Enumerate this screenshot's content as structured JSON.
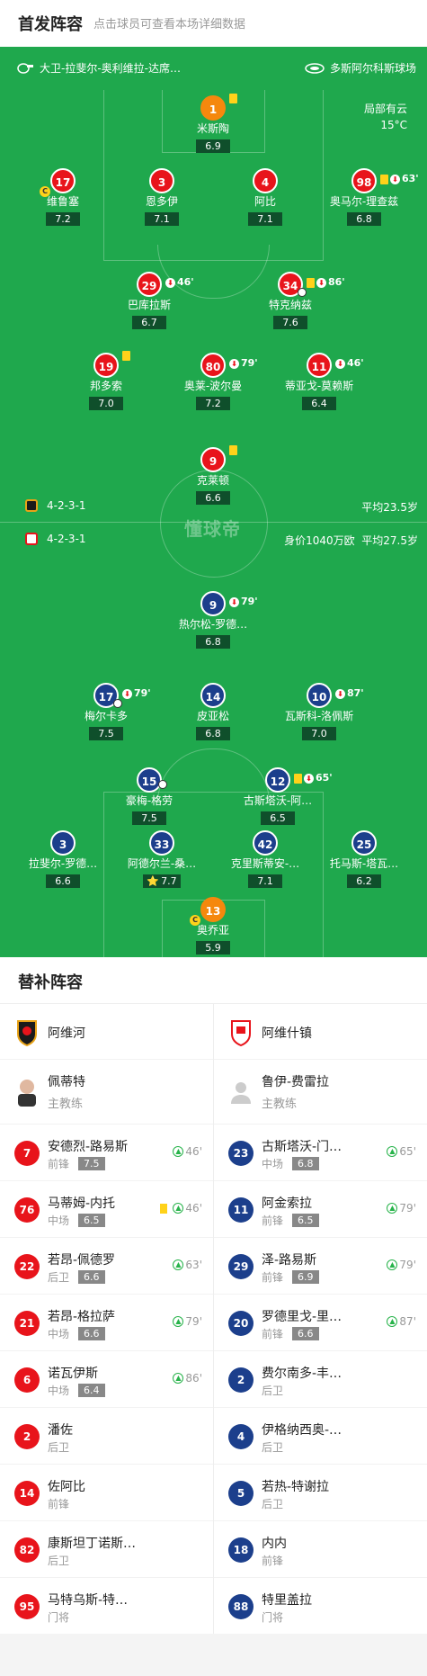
{
  "header": {
    "title": "首发阵容",
    "subtitle": "点击球员可查看本场详细数据"
  },
  "match": {
    "referee": "大卫-拉斐尔-奥利维拉-达席…",
    "stadium": "多斯阿尔科斯球场",
    "weather": "局部有云",
    "temp": "15°C",
    "watermark": "懂球帝"
  },
  "home_team": {
    "formation": "4-2-3-1",
    "avg_age": "平均23.5岁"
  },
  "away_team": {
    "formation": "4-2-3-1",
    "value": "身价1040万欧",
    "avg_age": "平均27.5岁"
  },
  "home_players": [
    {
      "num": "1",
      "name": "米斯陶",
      "rating": "6.9",
      "color": "orange",
      "yellow": true
    },
    {
      "num": "17",
      "name": "维鲁塞",
      "rating": "7.2",
      "captain": "C"
    },
    {
      "num": "3",
      "name": "恩多伊",
      "rating": "7.1"
    },
    {
      "num": "4",
      "name": "阿比",
      "rating": "7.1"
    },
    {
      "num": "98",
      "name": "奥马尔-理查兹",
      "rating": "6.8",
      "yellow": true,
      "sub": "63'"
    },
    {
      "num": "29",
      "name": "巴库拉斯",
      "rating": "6.7",
      "sub": "46'"
    },
    {
      "num": "34",
      "name": "特克纳兹",
      "rating": "7.6",
      "yellow": true,
      "sub": "86'",
      "goal": true
    },
    {
      "num": "19",
      "name": "邦多索",
      "rating": "7.0",
      "yellow": true
    },
    {
      "num": "80",
      "name": "奥莱-波尔曼",
      "rating": "7.2",
      "sub": "79'"
    },
    {
      "num": "11",
      "name": "蒂亚戈-莫赖斯",
      "rating": "6.4",
      "sub": "46'"
    },
    {
      "num": "9",
      "name": "克莱顿",
      "rating": "6.6",
      "yellow": true
    }
  ],
  "away_players": [
    {
      "num": "9",
      "name": "热尔松-罗德…",
      "rating": "6.8",
      "sub": "79'"
    },
    {
      "num": "17",
      "name": "梅尔卡多",
      "rating": "7.5",
      "sub": "79'",
      "goal": true
    },
    {
      "num": "14",
      "name": "皮亚松",
      "rating": "6.8"
    },
    {
      "num": "10",
      "name": "瓦斯科-洛佩斯",
      "rating": "7.0",
      "sub": "87'"
    },
    {
      "num": "15",
      "name": "豪梅-格劳",
      "rating": "7.5",
      "assist": true
    },
    {
      "num": "12",
      "name": "古斯塔沃-阿…",
      "rating": "6.5",
      "yellow": true,
      "sub": "65'"
    },
    {
      "num": "3",
      "name": "拉斐尔-罗德…",
      "rating": "6.6"
    },
    {
      "num": "33",
      "name": "阿德尔兰-桑…",
      "rating": "7.7",
      "star": "⭐"
    },
    {
      "num": "42",
      "name": "克里斯蒂安-…",
      "rating": "7.1"
    },
    {
      "num": "25",
      "name": "托马斯-塔瓦…",
      "rating": "6.2"
    },
    {
      "num": "13",
      "name": "奥乔亚",
      "rating": "5.9",
      "color": "orange",
      "captain": "C"
    }
  ],
  "subs": {
    "title": "替补阵容",
    "home": {
      "team": "阿维河",
      "coach": {
        "name": "佩蒂特",
        "role": "主教练"
      },
      "players": [
        {
          "num": "7",
          "name": "安德烈-路易斯",
          "pos": "前锋",
          "rating": "7.5",
          "in": "46'"
        },
        {
          "num": "76",
          "name": "马蒂姆-内托",
          "pos": "中场",
          "rating": "6.5",
          "in": "46'",
          "yellow": true
        },
        {
          "num": "22",
          "name": "若昂-佩德罗",
          "pos": "后卫",
          "rating": "6.6",
          "in": "63'"
        },
        {
          "num": "21",
          "name": "若昂-格拉萨",
          "pos": "中场",
          "rating": "6.6",
          "in": "79'"
        },
        {
          "num": "6",
          "name": "诺瓦伊斯",
          "pos": "中场",
          "rating": "6.4",
          "in": "86'"
        },
        {
          "num": "2",
          "name": "潘佐",
          "pos": "后卫"
        },
        {
          "num": "14",
          "name": "佐阿比",
          "pos": "前锋"
        },
        {
          "num": "82",
          "name": "康斯坦丁诺斯…",
          "pos": "后卫"
        },
        {
          "num": "95",
          "name": "马特乌斯-特…",
          "pos": "门将"
        }
      ]
    },
    "away": {
      "team": "阿维什镇",
      "coach": {
        "name": "鲁伊-费雷拉",
        "role": "主教练"
      },
      "players": [
        {
          "num": "23",
          "name": "古斯塔沃-门…",
          "pos": "中场",
          "rating": "6.8",
          "in": "65'"
        },
        {
          "num": "11",
          "name": "阿金索拉",
          "pos": "前锋",
          "rating": "6.5",
          "in": "79'"
        },
        {
          "num": "29",
          "name": "泽-路易斯",
          "pos": "前锋",
          "rating": "6.9",
          "in": "79'"
        },
        {
          "num": "20",
          "name": "罗德里戈-里…",
          "pos": "前锋",
          "rating": "6.6",
          "in": "87'"
        },
        {
          "num": "2",
          "name": "费尔南多-丰…",
          "pos": "后卫"
        },
        {
          "num": "4",
          "name": "伊格纳西奥-…",
          "pos": "后卫"
        },
        {
          "num": "5",
          "name": "若热-特谢拉",
          "pos": "后卫"
        },
        {
          "num": "18",
          "name": "内内",
          "pos": "前锋"
        },
        {
          "num": "88",
          "name": "特里盖拉",
          "pos": "门将"
        }
      ]
    }
  }
}
